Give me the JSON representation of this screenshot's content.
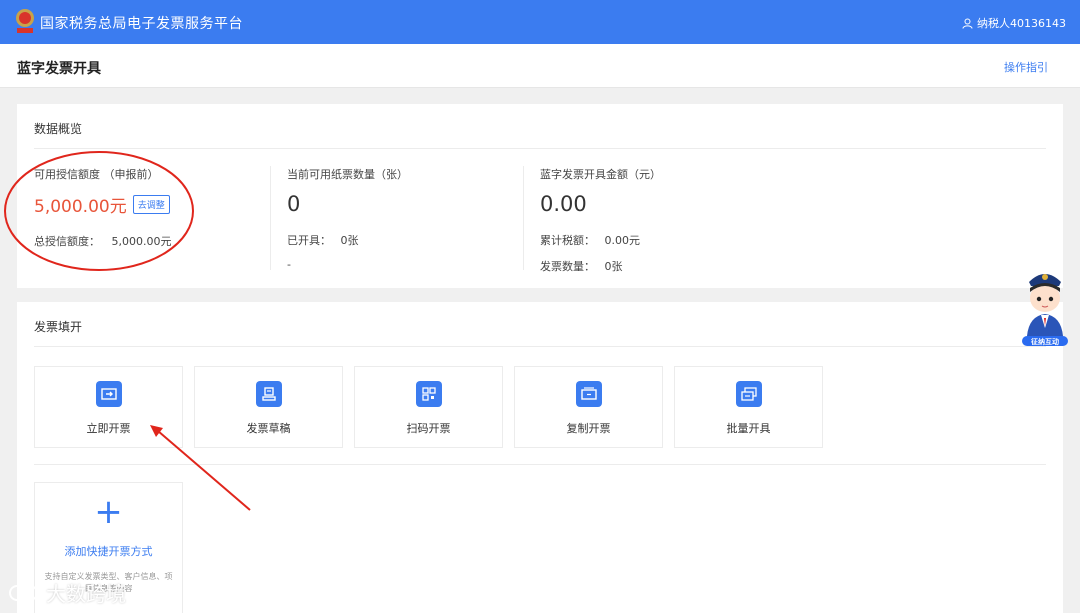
{
  "header": {
    "platform_title": "国家税务总局电子发票服务平台",
    "user_label": "纳税人40136143"
  },
  "page": {
    "title": "蓝字发票开具",
    "guide_link": "操作指引"
  },
  "overview": {
    "title": "数据概览",
    "credit": {
      "label": "可用授信额度 （申报前）",
      "value": "5,000.00元",
      "adjust_button": "去调整",
      "total_label": "总授信额度：",
      "total_value": "5,000.00元"
    },
    "paper": {
      "label": "当前可用纸票数量（张）",
      "value": "0",
      "issued_label": "已开具：",
      "issued_value": "0张",
      "extra": "-"
    },
    "amount": {
      "label": "蓝字发票开具金额（元）",
      "value": "0.00",
      "tax_label": "累计税额：",
      "tax_value": "0.00元",
      "count_label": "发票数量：",
      "count_value": "0张"
    }
  },
  "issue": {
    "title": "发票填开",
    "tiles": [
      {
        "label": "立即开票",
        "icon": "invoice-arrow-icon"
      },
      {
        "label": "发票草稿",
        "icon": "draft-icon"
      },
      {
        "label": "扫码开票",
        "icon": "qr-code-icon"
      },
      {
        "label": "复制开票",
        "icon": "copy-invoice-icon"
      },
      {
        "label": "批量开具",
        "icon": "batch-invoice-icon"
      }
    ],
    "add": {
      "label": "添加快捷开票方式",
      "desc": "支持自定义发票类型、客户信息、项目信息等内容"
    }
  },
  "mascot": {
    "badge": "征纳互动"
  },
  "watermark": {
    "text": "大数跨境"
  },
  "colors": {
    "brand": "#3b7cf0",
    "accent_red": "#e8553a"
  }
}
